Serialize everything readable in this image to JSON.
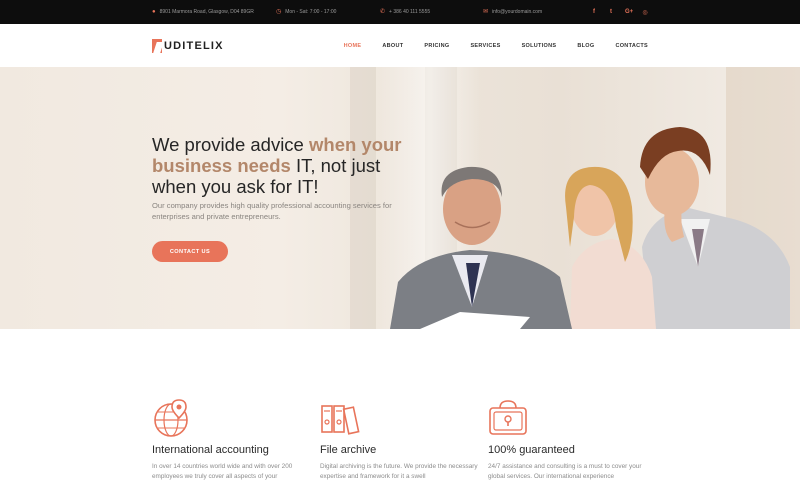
{
  "topbar": {
    "address": "8901 Marmora Road, Glasgow, D04 89GR",
    "hours": "Mon - Sat: 7:00 - 17:00",
    "phone": "+ 386 40 111 5555",
    "email": "info@yourdomain.com",
    "social": [
      "f",
      "t",
      "G+",
      "◎"
    ]
  },
  "brand": {
    "logo_text": "UDITELIX",
    "accent": "#e8745a"
  },
  "nav": {
    "items": [
      "HOME",
      "ABOUT",
      "PRICING",
      "SERVICES",
      "SOLUTIONS",
      "BLOG",
      "CONTACTS"
    ],
    "active": "HOME"
  },
  "hero": {
    "line1_plain": "We provide advice ",
    "line1_highlight": "when your",
    "line2_highlight": "business needs",
    "line2_plain": " IT, not just",
    "line3_plain": "when you ask for IT!",
    "subtitle": "Our company provides high quality professional accounting services for enterprises and private entrepreneurs.",
    "cta_label": "CONTACT US"
  },
  "features": [
    {
      "icon": "globe-pin-icon",
      "title": "International accounting",
      "text": "In over 14 countries world wide and with over 200 employees we truly cover all aspects of your"
    },
    {
      "icon": "binders-icon",
      "title": "File archive",
      "text": "Digital archiving is the future. We provide the necessary expertise and framework for it a swell"
    },
    {
      "icon": "safe-lock-icon",
      "title": "100% guaranteed",
      "text": "24/7 assistance and consulting is a must to cover your global services. Our international experience"
    }
  ]
}
